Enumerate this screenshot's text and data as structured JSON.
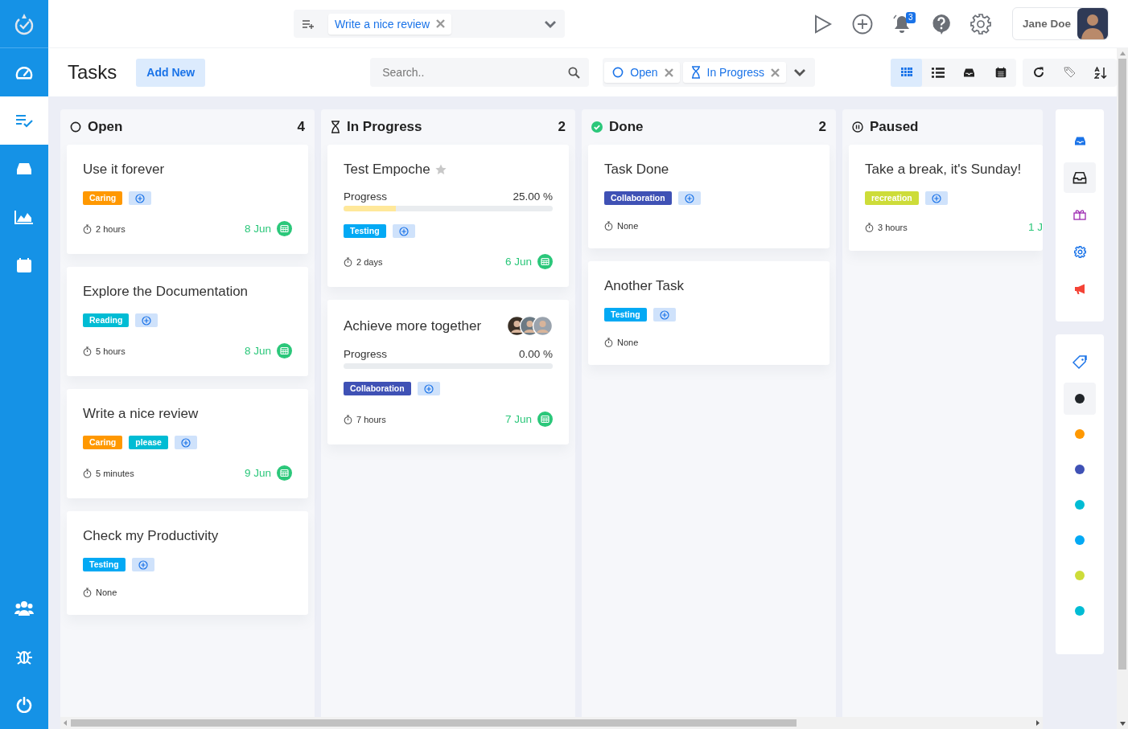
{
  "sidebar": {
    "items": [
      {
        "selected": false
      },
      {
        "selected": true
      },
      {
        "selected": false
      },
      {
        "selected": false
      },
      {
        "selected": false
      },
      {
        "selected": false
      },
      {
        "selected": false
      },
      {
        "selected": false
      }
    ]
  },
  "top_bar": {
    "quick_tasks": [
      {
        "label": "Write a nice review"
      }
    ],
    "notification_badge": "3",
    "user": {
      "name": "Jane Doe"
    }
  },
  "header": {
    "title": "Tasks",
    "add_button": "Add New",
    "search": {
      "placeholder": "Search.."
    },
    "filters": [
      {
        "label": "Open",
        "kind": "open"
      },
      {
        "label": "In Progress",
        "kind": "in_progress"
      }
    ],
    "views": [
      {
        "selected": true
      },
      {
        "selected": false
      },
      {
        "selected": false
      },
      {
        "selected": false
      }
    ]
  },
  "columns": [
    {
      "title": "Open",
      "kind": "open",
      "count": "4",
      "cards": [
        {
          "title": "Use it forever",
          "tags": [
            {
              "label": "Caring",
              "color": "#ff9800"
            }
          ],
          "duration": "2 hours",
          "due": "8 Jun"
        },
        {
          "title": "Explore the Documentation",
          "tags": [
            {
              "label": "Reading",
              "color": "#00bcd4"
            }
          ],
          "duration": "5 hours",
          "due": "8 Jun"
        },
        {
          "title": "Write a nice review",
          "tags": [
            {
              "label": "Caring",
              "color": "#ff9800"
            },
            {
              "label": "please",
              "color": "#00bcd4"
            }
          ],
          "duration": "5 minutes",
          "due": "9 Jun"
        },
        {
          "title": "Check my Productivity",
          "tags": [
            {
              "label": "Testing",
              "color": "#03a9f4"
            }
          ],
          "duration": "None"
        }
      ]
    },
    {
      "title": "In Progress",
      "kind": "in_progress",
      "count": "2",
      "cards": [
        {
          "title": "Test Empoche",
          "starred": false,
          "progress": {
            "label": "Progress",
            "reading": "25.00 %",
            "level": 0.25
          },
          "tags": [
            {
              "label": "Testing",
              "color": "#03a9f4"
            }
          ],
          "duration": "2 days",
          "due": "6 Jun"
        },
        {
          "title": "Achieve more together",
          "members": [
            {
              "kind": "picture"
            },
            {
              "kind": "picture"
            },
            {
              "kind": "picture"
            }
          ],
          "progress": {
            "label": "Progress",
            "reading": "0.00 %",
            "level": 0
          },
          "tags": [
            {
              "label": "Collaboration",
              "color": "#3f51b5"
            }
          ],
          "duration": "7 hours",
          "due": "7 Jun"
        }
      ]
    },
    {
      "title": "Done",
      "kind": "done",
      "count": "2",
      "cards": [
        {
          "title": "Task Done",
          "tags": [
            {
              "label": "Collaboration",
              "color": "#3f51b5"
            }
          ],
          "duration": "None"
        },
        {
          "title": "Another Task",
          "tags": [
            {
              "label": "Testing",
              "color": "#03a9f4"
            }
          ],
          "duration": "None"
        }
      ]
    },
    {
      "title": "Paused",
      "kind": "paused",
      "cards": [
        {
          "title": "Take a break, it's Sunday!",
          "tags": [
            {
              "label": "recreation",
              "color": "#cddc39"
            }
          ],
          "duration": "3 hours",
          "due": "1 J"
        }
      ]
    }
  ],
  "tools_panel": {
    "items": [
      {
        "selected": false
      },
      {
        "selected": true
      },
      {
        "selected": false
      },
      {
        "selected": false
      },
      {
        "selected": false
      }
    ]
  },
  "color_panel": {
    "colors": [
      {
        "color": "#212529",
        "selected": true
      },
      {
        "color": "#ff9800",
        "selected": false
      },
      {
        "color": "#3f51b5",
        "selected": false
      },
      {
        "color": "#00bcd4",
        "selected": false
      },
      {
        "color": "#03a9f4",
        "selected": false
      },
      {
        "color": "#cddc39",
        "selected": false
      },
      {
        "color": "#00bcd4",
        "selected": false
      }
    ]
  }
}
